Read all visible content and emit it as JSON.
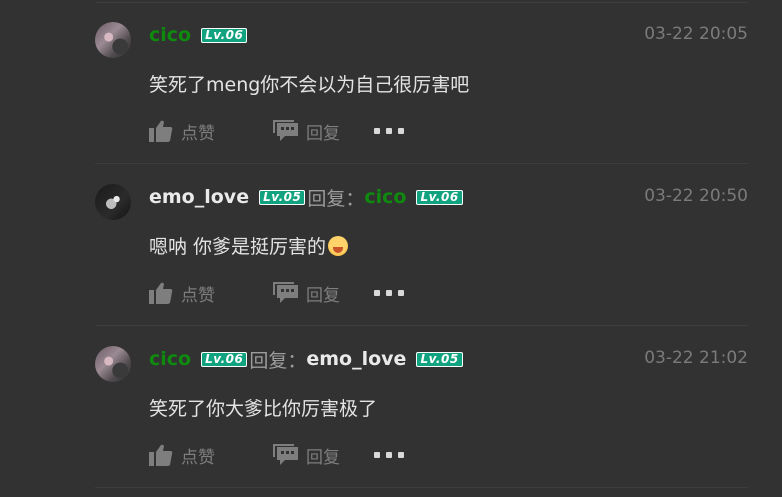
{
  "comments": [
    {
      "user": "cico",
      "level": "Lv.06",
      "time": "03-22 20:05",
      "text": "笑死了meng你不会以为自己很厉害吧",
      "like_label": "点赞",
      "reply_label": "回复"
    },
    {
      "user": "emo_love",
      "level": "Lv.05",
      "reply_word": "回复：",
      "reply_to_user": "cico",
      "reply_to_level": "Lv.06",
      "time": "03-22 20:50",
      "text": "嗯呐 你爹是挺厉害的",
      "like_label": "点赞",
      "reply_label": "回复"
    },
    {
      "user": "cico",
      "level": "Lv.06",
      "reply_word": "回复：",
      "reply_to_user": "emo_love",
      "reply_to_level": "Lv.05",
      "time": "03-22 21:02",
      "text": "笑死了你大爹比你厉害极了",
      "like_label": "点赞",
      "reply_label": "回复"
    }
  ],
  "icons": {
    "like": "thumbs-up-icon",
    "reply": "comment-icon",
    "more": "more-dots-icon",
    "emoji": "blushing-smile-emoji"
  },
  "colors": {
    "background": "#313231",
    "username_green": "#0f8a0f",
    "level_badge": "#11a37f",
    "muted": "#7d7e7d"
  }
}
